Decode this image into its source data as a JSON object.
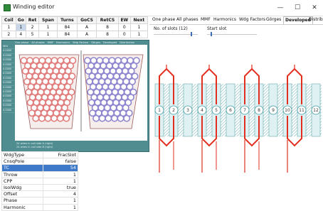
{
  "window": {
    "title": "Winding editor",
    "minimize": "—",
    "maximize": "☐",
    "close": "✕"
  },
  "coil_table": {
    "headers": [
      "Coil",
      "Go",
      "Ret",
      "Span",
      "Turns",
      "GoCS",
      "RetCS",
      "EW",
      "Next"
    ],
    "rows": [
      [
        "1",
        "1",
        "2",
        "1",
        "84",
        "A",
        "8",
        "0",
        "1"
      ],
      [
        "2",
        "4",
        "5",
        "1",
        "84",
        "A",
        "8",
        "0",
        "1"
      ]
    ]
  },
  "left_panel": {
    "tabs": [
      "One phase",
      "All phases",
      "MMF",
      "Harmonics",
      "Wdg Factors",
      "Görges",
      "Developed",
      "Distribution"
    ],
    "y_labels": [
      "Wht",
      "0.0000",
      "0.0000",
      "0.0000",
      "0.0000",
      "0.0000",
      "0.0000",
      "0.0000",
      "0.0000",
      "0.0000",
      "0.0000",
      "0.0000",
      "0.0000",
      "0.0000",
      "0.0000"
    ],
    "status_lines": [
      "24 wires in coil side A (right)",
      "24 wires in coil side B (right)"
    ],
    "colors": {
      "panel": "#4f8d91",
      "slot_fill": "#f6eeec",
      "red_wire": "#e07d7d",
      "blue_wire": "#8f86cf"
    }
  },
  "properties": [
    {
      "name": "WdgType",
      "value": "FracSlot"
    },
    {
      "name": "CnsqPole",
      "value": "false"
    },
    {
      "name": "TC",
      "value": "54",
      "selected": true
    },
    {
      "name": "Throw",
      "value": "1"
    },
    {
      "name": "CPP",
      "value": "1"
    },
    {
      "name": "IsolWdg",
      "value": "true"
    },
    {
      "name": "Offset",
      "value": "4"
    },
    {
      "name": "Phase",
      "value": "1"
    },
    {
      "name": "Harmonic",
      "value": "1"
    }
  ],
  "right_tabs": [
    "One phase",
    "All phases",
    "MMF",
    "Harmonics",
    "Wdg Factors",
    "Görges",
    "Developed",
    "Distribution"
  ],
  "active_tab": "Developed",
  "controls": {
    "slots_label": "No. of slots (12)",
    "slots_value": 12,
    "slots_max": 14,
    "start_label": "Start slot",
    "start_value": 1,
    "start_max": 12
  },
  "winding": {
    "slots": [
      "1",
      "2",
      "3",
      "4",
      "5",
      "6",
      "7",
      "8",
      "9",
      "10",
      "11",
      "12"
    ],
    "highlighted": [
      "1",
      "4",
      "7",
      "10"
    ],
    "colors": {
      "slot": "#dff1f2",
      "hatch": "#4a9ca0",
      "circle": "#3f9aa0",
      "coil": "#e1301f"
    }
  },
  "icons": {
    "app": "winding-app-icon"
  }
}
